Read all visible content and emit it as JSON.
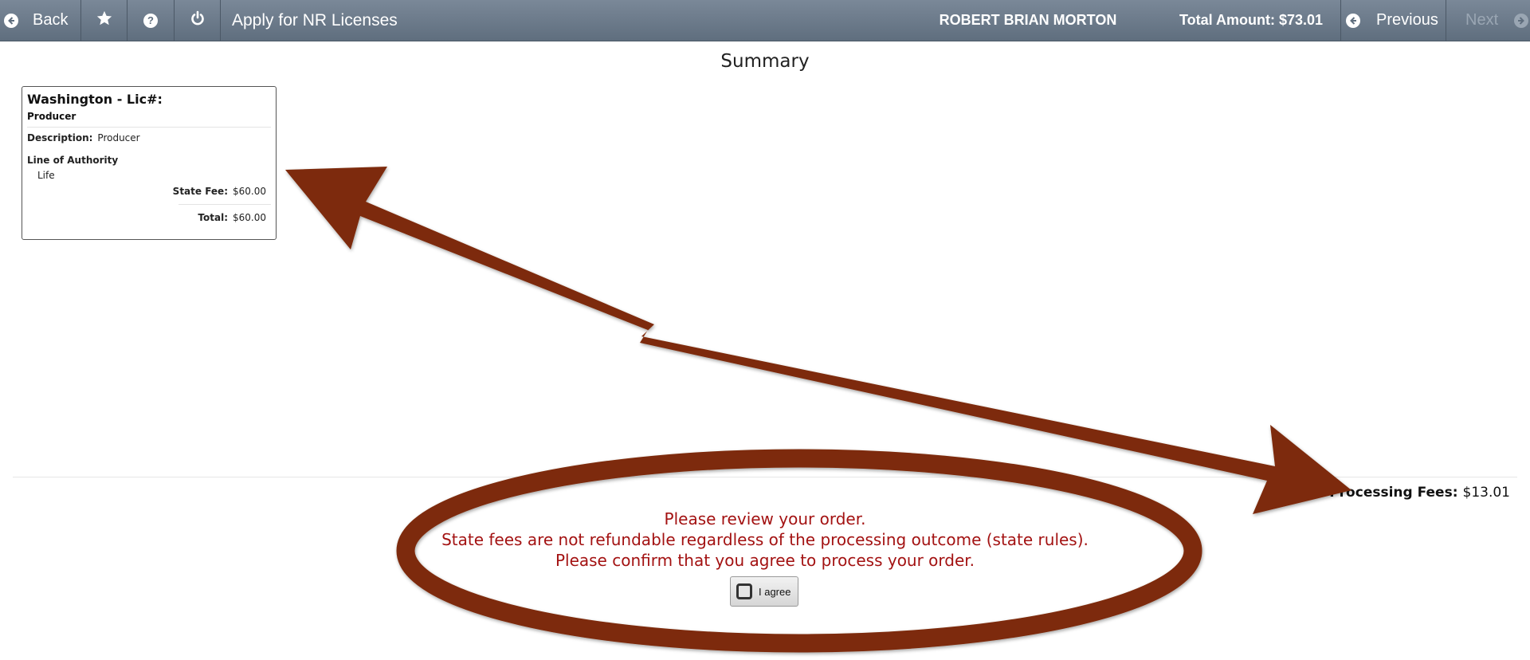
{
  "topbar": {
    "back_label": "Back",
    "app_title": "Apply for NR Licenses",
    "user_name": "ROBERT BRIAN MORTON",
    "total_amount": "Total Amount: $73.01",
    "previous_label": "Previous",
    "next_label": "Next",
    "icons": [
      "back-arrow-icon",
      "star-icon",
      "help-icon",
      "power-icon",
      "previous-arrow-icon",
      "next-arrow-icon"
    ]
  },
  "summary": {
    "title": "Summary",
    "license": {
      "title": "Washington - Lic#:",
      "type": "Producer",
      "description_label": "Description:",
      "description_value": "Producer",
      "loa_label": "Line of Authority",
      "loa_items": [
        "Life"
      ],
      "state_fee_label": "State Fee:",
      "state_fee_value": "$60.00",
      "total_label": "Total:",
      "total_value": "$60.00"
    },
    "processing_label": "Processing Fees:",
    "processing_value": "$13.01"
  },
  "notice": {
    "line1": "Please review your order.",
    "line2": "State fees are not refundable regardless of the processing outcome (state rules).",
    "line3": "Please confirm that you agree to process your order.",
    "agree_label": "I agree",
    "agree_checked": false
  },
  "annotation": {
    "color": "#7d2a08"
  }
}
